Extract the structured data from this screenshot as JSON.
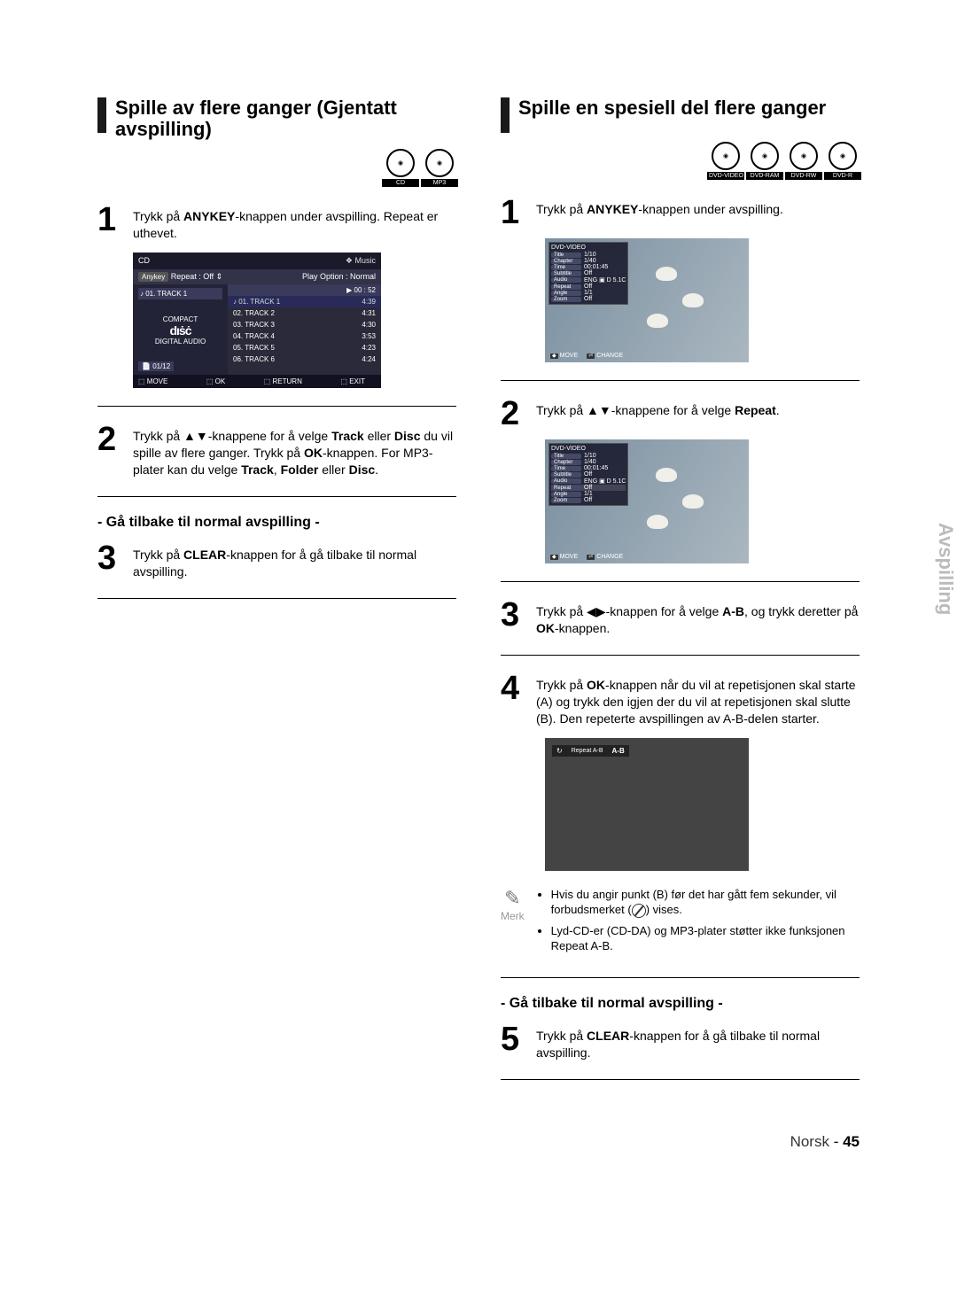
{
  "left": {
    "title": "Spille av flere ganger (Gjentatt avspilling)",
    "discs": [
      "CD",
      "MP3"
    ],
    "step1": "Trykk på ANYKEY-knappen under avspilling. Repeat er uthevet.",
    "step2": "Trykk på ▲▼-knappene for å velge Track eller Disc du vil spille av flere ganger. Trykk på OK-knappen. For MP3-plater kan du velge Track, Folder eller Disc.",
    "sub": "- Gå tilbake til normal avspilling -",
    "step3": "Trykk på CLEAR-knappen for å gå tilbake til normal avspilling.",
    "osd": {
      "hdrL": "CD",
      "hdrR": "❖ Music",
      "repeat": "Repeat : Off",
      "playopt": "Play Option : Normal",
      "curtrack": "01. TRACK 1",
      "time": "▶  00 : 52",
      "count": "01/12",
      "tracks": [
        {
          "n": "01. TRACK 1",
          "t": "4:39"
        },
        {
          "n": "02. TRACK 2",
          "t": "4:31"
        },
        {
          "n": "03. TRACK 3",
          "t": "4:30"
        },
        {
          "n": "04. TRACK 4",
          "t": "3:53"
        },
        {
          "n": "05. TRACK 5",
          "t": "4:23"
        },
        {
          "n": "06. TRACK 6",
          "t": "4:24"
        }
      ],
      "foot": [
        "MOVE",
        "OK",
        "RETURN",
        "EXIT"
      ]
    }
  },
  "right": {
    "title": "Spille en spesiell del flere ganger",
    "discs": [
      "DVD-VIDEO",
      "DVD-RAM",
      "DVD-RW",
      "DVD-R"
    ],
    "step1": "Trykk på ANYKEY-knappen under avspilling.",
    "step2": "Trykk på ▲▼-knappene for å velge Repeat.",
    "step3": "Trykk på ◀▶-knappen for å velge A-B, og trykk deretter på OK-knappen.",
    "step4": "Trykk på OK-knappen når du vil at repetisjonen skal starte (A) og trykk den igjen der du vil at repetisjonen skal slutte (B). Den repeterte avspillingen av A-B-delen starter.",
    "sub": "- Gå tilbake til normal avspilling -",
    "step5": "Trykk på CLEAR-knappen for å gå tilbake til normal avspilling.",
    "osd": {
      "hdr": "DVD-VIDEO",
      "rows": [
        {
          "l": "Title",
          "v": "1/10"
        },
        {
          "l": "Chapter",
          "v": "1/40"
        },
        {
          "l": "Time",
          "v": "00:01:45"
        },
        {
          "l": "Subtitle",
          "v": "Off"
        },
        {
          "l": "Audio",
          "v": "ENG ▣ D 5.1C"
        },
        {
          "l": "Repeat",
          "v": "Off"
        },
        {
          "l": "Angle",
          "v": "1/1"
        },
        {
          "l": "Zoom",
          "v": "Off"
        }
      ],
      "foot": [
        "MOVE",
        "CHANGE"
      ]
    },
    "ab": {
      "label": "Repeat A-B",
      "val": "A-B"
    },
    "noteLabel": "Merk",
    "notes": [
      "Hvis du angir punkt (B) før det har gått fem sekunder, vil forbudsmerket ( ⊘ ) vises.",
      "Lyd-CD-er (CD-DA) og MP3-plater støtter ikke funksjonen Repeat A-B."
    ]
  },
  "sideTab": "Avspilling",
  "footer": {
    "lang": "Norsk",
    "sep": " - ",
    "page": "45"
  }
}
